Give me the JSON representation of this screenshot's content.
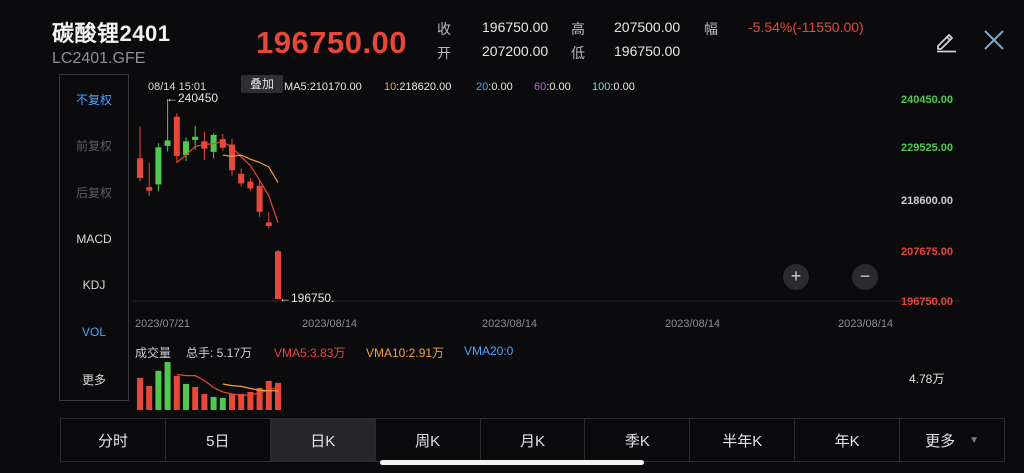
{
  "header": {
    "title": "碳酸锂2401",
    "code": "LC2401.GFE",
    "price": "196750.00",
    "quotes": [
      {
        "label": "收",
        "value": "196750.00"
      },
      {
        "label": "开",
        "value": "207200.00"
      },
      {
        "label": "高",
        "value": "207500.00"
      },
      {
        "label": "低",
        "value": "196750.00"
      },
      {
        "label": "幅",
        "value": "-5.54%(-11550.00)"
      }
    ]
  },
  "sidebar": {
    "items": [
      "不复权",
      "前复权",
      "后复权",
      "MACD",
      "KDJ",
      "VOL",
      "更多"
    ]
  },
  "chart": {
    "overlay_label": "叠加",
    "timestamp": "08/14 15:01",
    "high_mark": "240450",
    "low_mark": "196750.",
    "ma": [
      {
        "key": "MA5",
        "value": "210170.00",
        "color": "#e8e8e8"
      },
      {
        "key": "10",
        "value": "218620.00",
        "color": "#f0a53a"
      },
      {
        "key": "20",
        "value": "0.00",
        "color": "#4da3ff"
      },
      {
        "key": "60",
        "value": "0.00",
        "color": "#c45ad8"
      },
      {
        "key": "100",
        "value": "0.00",
        "color": "#7fd3e0"
      }
    ],
    "axis_values": [
      "240450.00",
      "229525.00",
      "218600.00",
      "207675.00",
      "196750.00"
    ],
    "dates": [
      "2023/07/21",
      "2023/08/14",
      "2023/08/14",
      "2023/08/14",
      "2023/08/14"
    ],
    "colors": {
      "up": "#4ec94e",
      "down": "#e8473b",
      "ma5": "#e8473b",
      "ma10": "#f0a53a"
    }
  },
  "volume": {
    "label": "成交量",
    "total": "总手: 5.17万",
    "vma5": "VMA5:3.83万",
    "vma10": "VMA10:2.91万",
    "vma20": "VMA20:0",
    "axis_value": "4.78万"
  },
  "tabs": [
    "分时",
    "5日",
    "日K",
    "周K",
    "月K",
    "季K",
    "半年K",
    "年K",
    "更多"
  ],
  "chart_data": {
    "type": "candlestick",
    "ylim": [
      196750,
      240450
    ],
    "candles": [
      {
        "o": 227500,
        "h": 234500,
        "l": 222500,
        "c": 223200
      },
      {
        "o": 221200,
        "h": 226500,
        "l": 219200,
        "c": 220400
      },
      {
        "o": 221800,
        "h": 230800,
        "l": 220300,
        "c": 229900
      },
      {
        "o": 230200,
        "h": 240450,
        "l": 229000,
        "c": 231400
      },
      {
        "o": 236600,
        "h": 237300,
        "l": 226400,
        "c": 228000
      },
      {
        "o": 228200,
        "h": 232000,
        "l": 226900,
        "c": 231200
      },
      {
        "o": 231500,
        "h": 234600,
        "l": 229400,
        "c": 232200
      },
      {
        "o": 231200,
        "h": 233300,
        "l": 227100,
        "c": 229600
      },
      {
        "o": 228900,
        "h": 232900,
        "l": 227500,
        "c": 232600
      },
      {
        "o": 231700,
        "h": 232800,
        "l": 229200,
        "c": 229800
      },
      {
        "o": 230500,
        "h": 231700,
        "l": 223700,
        "c": 224900
      },
      {
        "o": 224100,
        "h": 225300,
        "l": 221300,
        "c": 222000
      },
      {
        "o": 222400,
        "h": 223200,
        "l": 220400,
        "c": 220900
      },
      {
        "o": 221500,
        "h": 222700,
        "l": 214700,
        "c": 215800
      },
      {
        "o": 213500,
        "h": 215700,
        "l": 212200,
        "c": 212700
      },
      {
        "o": 207200,
        "h": 207500,
        "l": 196750,
        "c": 196750
      }
    ],
    "ma5": [
      null,
      null,
      null,
      null,
      226600,
      228200,
      230100,
      230500,
      230700,
      231100,
      229900,
      227800,
      225900,
      222700,
      219300,
      213400
    ],
    "ma10": [
      null,
      null,
      null,
      null,
      null,
      null,
      null,
      null,
      null,
      228200,
      227900,
      228200,
      227300,
      226600,
      225600,
      222200
    ],
    "volumes": [
      {
        "v": 3.2,
        "up": false
      },
      {
        "v": 2.4,
        "up": false
      },
      {
        "v": 3.9,
        "up": true
      },
      {
        "v": 4.78,
        "up": true
      },
      {
        "v": 3.4,
        "up": false
      },
      {
        "v": 2.6,
        "up": true
      },
      {
        "v": 2.3,
        "up": false
      },
      {
        "v": 1.6,
        "up": false
      },
      {
        "v": 1.3,
        "up": true
      },
      {
        "v": 1.2,
        "up": true
      },
      {
        "v": 1.6,
        "up": false
      },
      {
        "v": 1.6,
        "up": false
      },
      {
        "v": 1.8,
        "up": false
      },
      {
        "v": 2.2,
        "up": false
      },
      {
        "v": 2.9,
        "up": false
      },
      {
        "v": 2.7,
        "up": false
      }
    ],
    "vma5": [
      null,
      null,
      null,
      null,
      3.54,
      3.42,
      3.42,
      2.94,
      2.24,
      1.8,
      1.6,
      1.46,
      1.5,
      1.68,
      2.02,
      2.24
    ],
    "vma10": [
      null,
      null,
      null,
      null,
      null,
      null,
      null,
      null,
      null,
      2.59,
      2.43,
      2.35,
      2.14,
      1.97,
      1.92,
      1.93
    ]
  }
}
